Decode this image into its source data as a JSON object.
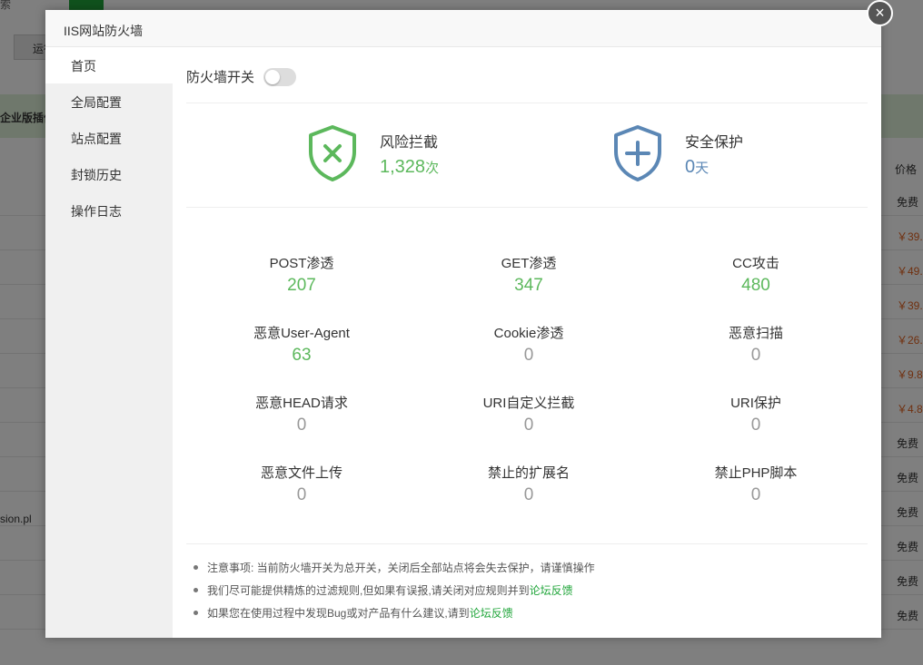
{
  "background": {
    "search_text": "索",
    "run_button": "运行",
    "green_bar_text": "企业版插件",
    "price_header": "价格",
    "rows": [
      {
        "price": "免费",
        "kind": "free"
      },
      {
        "price": "￥39.",
        "kind": "paid"
      },
      {
        "price": "￥49.",
        "kind": "paid"
      },
      {
        "price": "￥39.",
        "kind": "paid"
      },
      {
        "price": "￥26.",
        "kind": "paid"
      },
      {
        "price": "￥9.8",
        "kind": "paid"
      },
      {
        "price": "￥4.8",
        "kind": "paid"
      },
      {
        "price": "免费",
        "kind": "free"
      },
      {
        "price": "免费",
        "kind": "free"
      },
      {
        "price": "免费",
        "kind": "free"
      },
      {
        "price": "免费",
        "kind": "free"
      },
      {
        "price": "免费",
        "kind": "free"
      },
      {
        "price": "免费",
        "kind": "free"
      }
    ],
    "row_left_text": "sion.pl"
  },
  "modal": {
    "title": "IIS网站防火墙",
    "close_icon": "×"
  },
  "sidebar": {
    "items": [
      {
        "label": "首页"
      },
      {
        "label": "全局配置"
      },
      {
        "label": "站点配置"
      },
      {
        "label": "封锁历史"
      },
      {
        "label": "操作日志"
      }
    ]
  },
  "firewall_switch": {
    "label": "防火墙开关",
    "state": "off"
  },
  "summary": {
    "risk": {
      "title": "风险拦截",
      "value": "1,328",
      "unit": "次",
      "color": "#5cb85c"
    },
    "protection": {
      "title": "安全保护",
      "value": "0",
      "unit": "天",
      "color": "#5b87b5"
    }
  },
  "stats": [
    {
      "label": "POST渗透",
      "value": "207"
    },
    {
      "label": "GET渗透",
      "value": "347"
    },
    {
      "label": "CC攻击",
      "value": "480"
    },
    {
      "label": "恶意User-Agent",
      "value": "63"
    },
    {
      "label": "Cookie渗透",
      "value": "0"
    },
    {
      "label": "恶意扫描",
      "value": "0"
    },
    {
      "label": "恶意HEAD请求",
      "value": "0"
    },
    {
      "label": "URI自定义拦截",
      "value": "0"
    },
    {
      "label": "URI保护",
      "value": "0"
    },
    {
      "label": "恶意文件上传",
      "value": "0"
    },
    {
      "label": "禁止的扩展名",
      "value": "0"
    },
    {
      "label": "禁止PHP脚本",
      "value": "0"
    }
  ],
  "notes": [
    {
      "text": "注意事项: 当前防火墙开关为总开关，关闭后全部站点将会失去保护，请谨慎操作",
      "link": ""
    },
    {
      "text": "我们尽可能提供精炼的过滤规则,但如果有误报,请关闭对应规则并到",
      "link": "论坛反馈"
    },
    {
      "text": "如果您在使用过程中发现Bug或对产品有什么建议,请到",
      "link": "论坛反馈"
    }
  ],
  "colors": {
    "accent": "#20a53a",
    "positive": "#5cb85c",
    "zero": "#999999",
    "shield_blue": "#5b87b5"
  }
}
